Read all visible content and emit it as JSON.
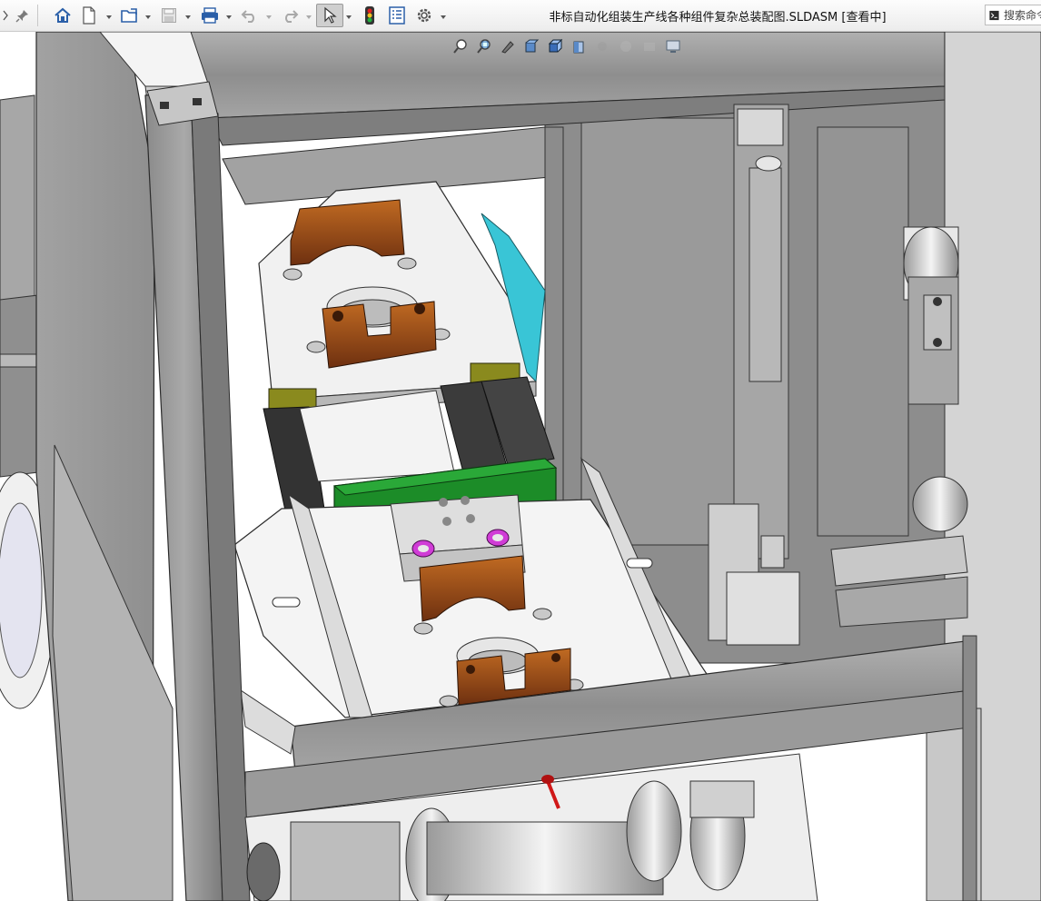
{
  "window": {
    "title": "非标自动化组装生产线各种组件复杂总装配图.SLDASM [查看中]"
  },
  "toolbar": {
    "items": [
      {
        "name": "expand-icon"
      },
      {
        "name": "pin-icon"
      },
      {
        "name": "home-icon"
      },
      {
        "name": "new-document-icon"
      },
      {
        "name": "open-folder-icon"
      },
      {
        "name": "save-icon"
      },
      {
        "name": "print-icon"
      },
      {
        "name": "undo-icon"
      },
      {
        "name": "redo-icon"
      },
      {
        "name": "select-cursor-icon"
      },
      {
        "name": "rebuild-traffic-light-icon"
      },
      {
        "name": "file-properties-icon"
      },
      {
        "name": "options-gear-icon"
      }
    ]
  },
  "search": {
    "placeholder": "搜索命令"
  },
  "view_toolbar": {
    "items": [
      "zoom-to-fit-icon",
      "zoom-to-area-icon",
      "previous-view-icon",
      "section-view-icon",
      "view-orientation-icon",
      "display-style-icon",
      "hide-show-items-icon",
      "edit-appearance-icon",
      "apply-scene-icon",
      "view-settings-icon"
    ]
  },
  "colors": {
    "frame_gray": "#9b9b9b",
    "frame_dark": "#6e6e6e",
    "plate_white": "#f2f2f2",
    "copper": "#b8621e",
    "copper_dark": "#6a2e0c",
    "green_bar": "#1c8c28",
    "cyan_part": "#39c5d6",
    "olive_block": "#8a8a1e",
    "magenta_ring": "#d03cd6",
    "red_pin": "#d01818"
  }
}
